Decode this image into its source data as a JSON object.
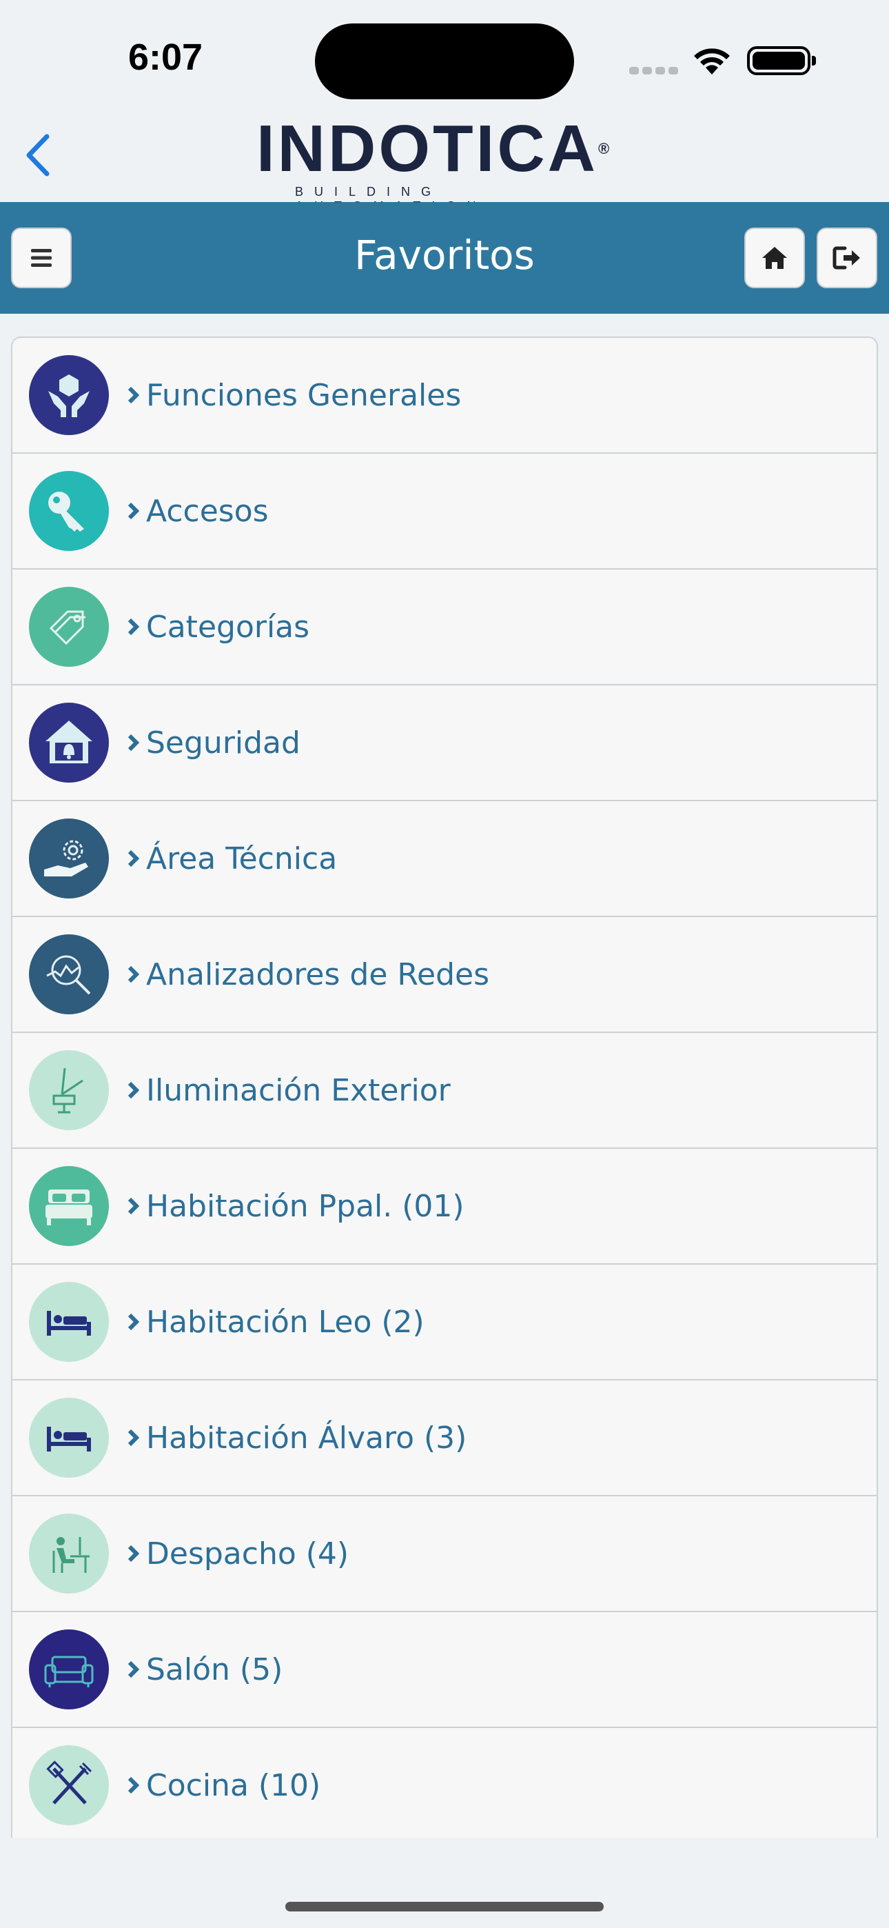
{
  "status_bar": {
    "time": "6:07"
  },
  "header": {
    "logo_text": "INDOTICA",
    "logo_subtext": "BUILDING AUTOMATION",
    "logo_mark": "®",
    "back_icon": "chevron-left-icon"
  },
  "nav": {
    "title": "Favoritos",
    "menu_icon": "hamburger-menu-icon",
    "home_icon": "home-icon",
    "logout_icon": "logout-icon"
  },
  "colors": {
    "nav_bar": "#2e789f",
    "label_text": "#2c6f98",
    "list_background": "#f7f7f7"
  },
  "items": [
    {
      "label": "Funciones Generales",
      "icon": "hands-hexagon-icon",
      "circle": "#2f3387"
    },
    {
      "label": "Accesos",
      "icon": "key-icon",
      "circle": "#26b8b4"
    },
    {
      "label": "Categorías",
      "icon": "tags-icon",
      "circle": "#4fbb9b"
    },
    {
      "label": "Seguridad",
      "icon": "house-bell-icon",
      "circle": "#2f3387"
    },
    {
      "label": "Área Técnica",
      "icon": "gear-hand-icon",
      "circle": "#2f5b7c"
    },
    {
      "label": "Analizadores de Redes",
      "icon": "magnifier-chart-icon",
      "circle": "#2f5b7c"
    },
    {
      "label": "Iluminación Exterior",
      "icon": "garden-lamp-icon",
      "circle": "#bfe5d6"
    },
    {
      "label": "Habitación Ppal. (01)",
      "icon": "double-bed-icon",
      "circle": "#4fbb9b"
    },
    {
      "label": "Habitación Leo (2)",
      "icon": "single-bed-icon",
      "circle": "#bfe5d6"
    },
    {
      "label": "Habitación Álvaro (3)",
      "icon": "single-bed-icon",
      "circle": "#bfe5d6"
    },
    {
      "label": "Despacho (4)",
      "icon": "office-desk-icon",
      "circle": "#bfe5d6"
    },
    {
      "label": "Salón (5)",
      "icon": "sofa-icon",
      "circle": "#2a2580"
    },
    {
      "label": "Cocina (10)",
      "icon": "kitchen-utensils-icon",
      "circle": "#bfe5d6"
    }
  ]
}
